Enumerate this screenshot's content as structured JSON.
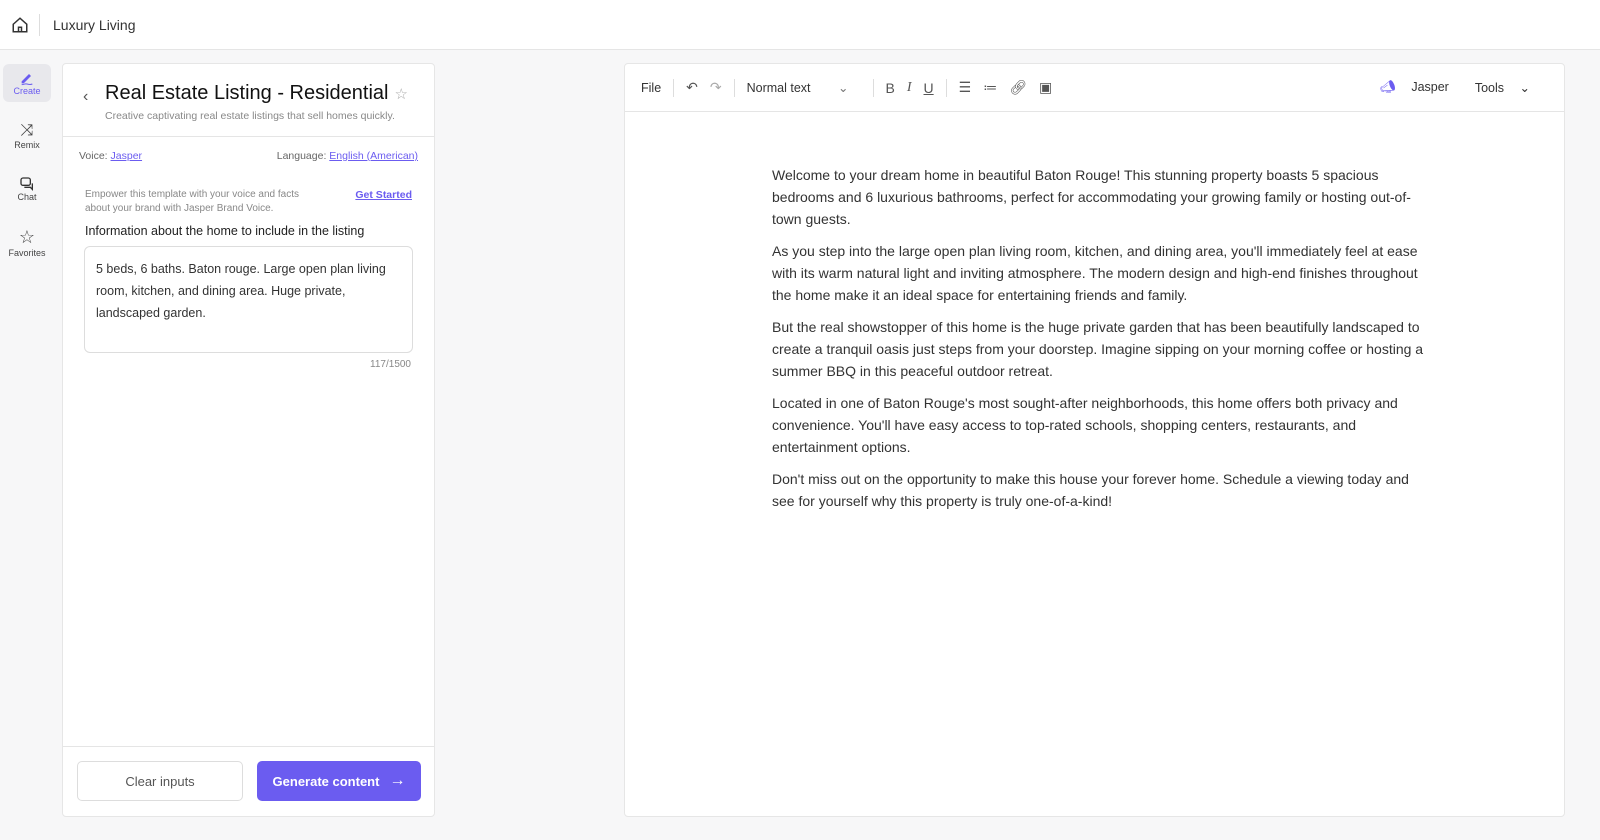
{
  "topbar": {
    "title": "Luxury Living"
  },
  "rail": [
    {
      "label": "Create",
      "icon": "pen-icon"
    },
    {
      "label": "Remix",
      "icon": "shuffle-icon"
    },
    {
      "label": "Chat",
      "icon": "chat-icon"
    },
    {
      "label": "Favorites",
      "icon": "star-icon"
    }
  ],
  "panel": {
    "title": "Real Estate Listing - Residential",
    "subtitle": "Creative captivating real estate listings that sell homes quickly.",
    "voice_label": "Voice:",
    "voice_value": "Jasper",
    "language_label": "Language:",
    "language_value": "English (American)",
    "brand_text": "Empower this template with your voice and facts about your brand with Jasper Brand Voice.",
    "get_started": "Get Started",
    "field_label": "Information about the home to include in the listing",
    "field_value": "5 beds, 6 baths. Baton rouge. Large open plan living room, kitchen, and dining area. Huge private, landscaped garden.",
    "count": "117/1500",
    "clear": "Clear inputs",
    "generate": "Generate content"
  },
  "toolbar": {
    "file": "File",
    "style": "Normal text",
    "jasper": "Jasper",
    "tools": "Tools"
  },
  "doc": [
    "Welcome to your dream home in beautiful Baton Rouge! This stunning property boasts 5 spacious bedrooms and 6 luxurious bathrooms, perfect for accommodating your growing family or hosting out-of-town guests.",
    "As you step into the large open plan living room, kitchen, and dining area, you'll immediately feel at ease with its warm natural light and inviting atmosphere. The modern design and high-end finishes throughout the home make it an ideal space for entertaining friends and family.",
    "But the real showstopper of this home is the huge private garden that has been beautifully landscaped to create a tranquil oasis just steps from your doorstep. Imagine sipping on your morning coffee or hosting a summer BBQ in this peaceful outdoor retreat.",
    "Located in one of Baton Rouge's most sought-after neighborhoods, this home offers both privacy and convenience. You'll have easy access to top-rated schools, shopping centers, restaurants, and entertainment options.",
    "Don't miss out on the opportunity to make this house your forever home. Schedule a viewing today and see for yourself why this property is truly one-of-a-kind!"
  ],
  "colors": {
    "accent": "#6b5cf0"
  }
}
